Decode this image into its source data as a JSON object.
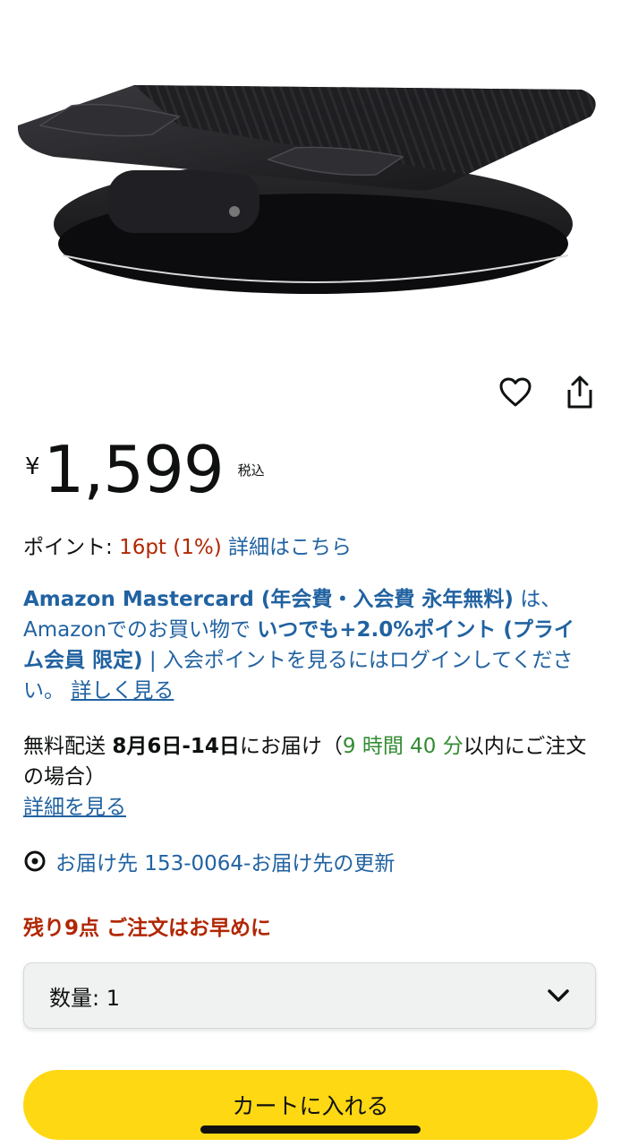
{
  "product": {
    "image_alt": "laptop-stand-image"
  },
  "actions": {
    "wishlist_icon": "heart-icon",
    "share_icon": "share-icon"
  },
  "price": {
    "symbol": "¥",
    "amount": "1,599",
    "tax_label": "税込"
  },
  "points": {
    "label": "ポイント: ",
    "value": "16pt",
    "percent": "(1%)",
    "details_link": "詳細はこちら"
  },
  "card_promo": {
    "title": "Amazon Mastercard (年会費・入会費 永年無料)",
    "line1": "は、Amazonでのお買い物で ",
    "highlight": "いつでも+2.0%ポイント (プライム会員 限定)",
    "separator": " | ",
    "login_text": "入会ポイントを見るにはログインしてください。",
    "more_link": "詳しく見る"
  },
  "delivery": {
    "prefix": "無料配送",
    "date": "8月6日-14日",
    "suffix": "にお届け（",
    "countdown": "9 時間 40 分",
    "suffix2": "以内にご注文の場合）",
    "details_link": "詳細を見る"
  },
  "location": {
    "icon": "location-pin-icon",
    "text": "お届け先 153-0064-お届け先の更新"
  },
  "stock": {
    "text": "残り9点 ご注文はお早めに"
  },
  "quantity": {
    "label": "数量: 1"
  },
  "cart": {
    "label": "カートに入れる"
  },
  "colors": {
    "link": "#2162a1",
    "price_orange": "#b12704",
    "countdown_green": "#338c33",
    "cart_yellow": "#ffd814"
  }
}
